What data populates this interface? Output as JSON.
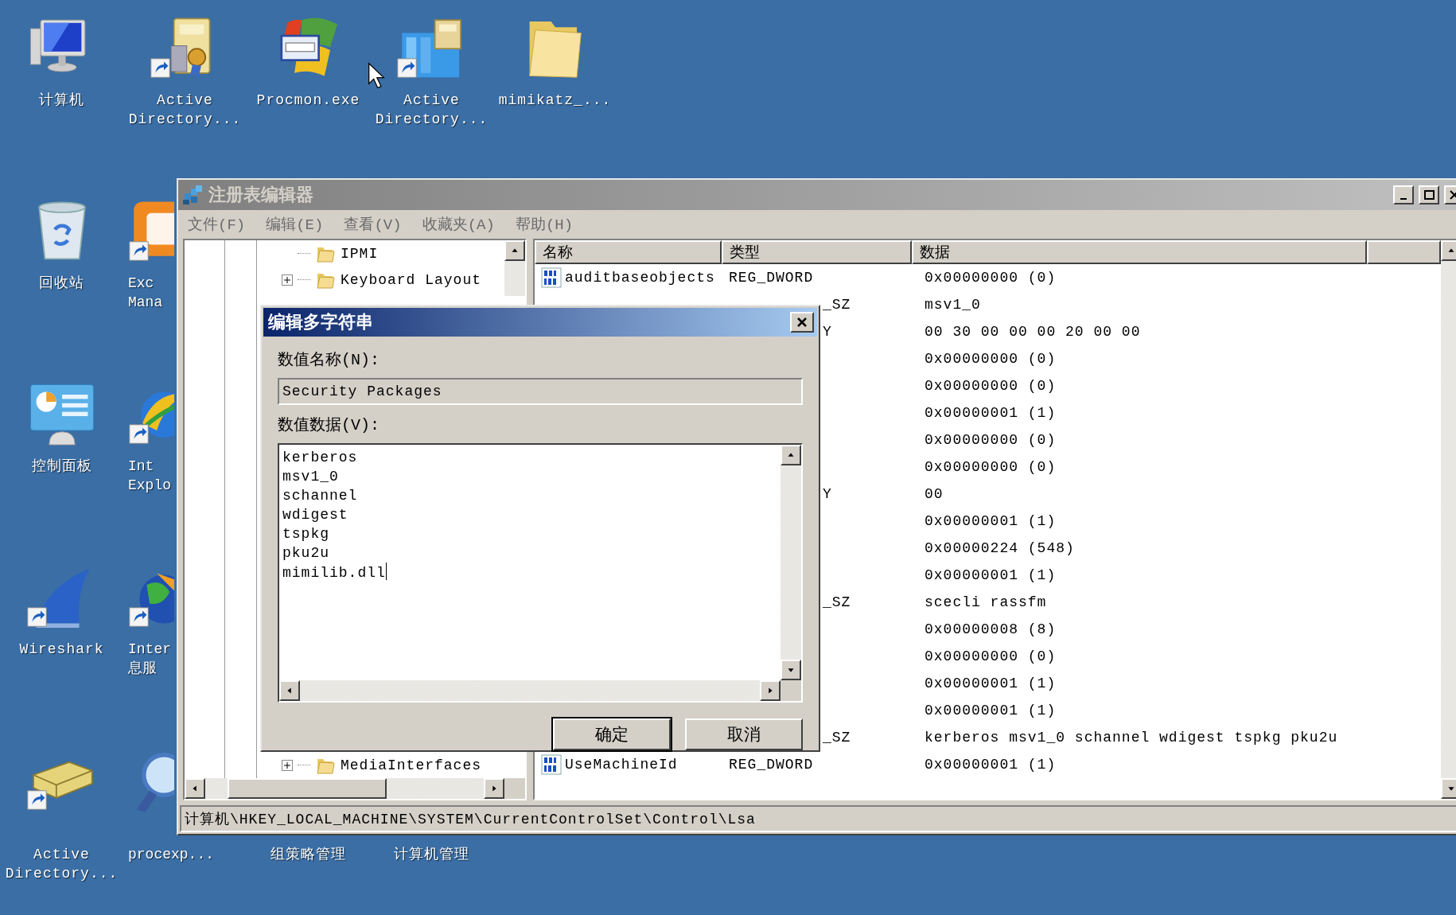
{
  "desktop_icons": [
    {
      "kind": "computer",
      "shortcut": false,
      "lines": [
        "计算机"
      ]
    },
    {
      "kind": "recycle_bin",
      "shortcut": false,
      "lines": [
        "回收站"
      ]
    },
    {
      "kind": "control_panel",
      "shortcut": false,
      "lines": [
        "控制面板"
      ]
    },
    {
      "kind": "shark_fin",
      "shortcut": true,
      "lines": [
        "Wireshark"
      ]
    },
    {
      "kind": "drive",
      "shortcut": true,
      "lines": [
        "Active",
        "Directory..."
      ]
    },
    {
      "kind": "book",
      "shortcut": true,
      "lines": [
        "Active",
        "Directory..."
      ]
    },
    {
      "kind": "app",
      "shortcut": true,
      "lines": [
        "Exc",
        "Mana"
      ]
    },
    {
      "kind": "browser",
      "shortcut": true,
      "lines": [
        "Int",
        "Explo"
      ]
    },
    {
      "kind": "globe",
      "shortcut": true,
      "lines": [
        "Inter",
        "息服"
      ]
    },
    {
      "kind": "magnifier",
      "shortcut": false,
      "lines": [
        "procexp..."
      ]
    },
    {
      "kind": "window",
      "shortcut": false,
      "lines": [
        "Procmon.exe"
      ]
    },
    {
      "kind": "covered",
      "lines": [
        "组策略管理"
      ]
    },
    {
      "kind": "building",
      "shortcut": true,
      "lines": [
        "Active",
        "Directory..."
      ]
    },
    {
      "kind": "covered",
      "lines": [
        "计算机管理"
      ]
    },
    {
      "kind": "folder",
      "shortcut": false,
      "lines": [
        "mimikatz_..."
      ]
    }
  ],
  "registry_editor": {
    "title": "注册表编辑器",
    "menu": [
      "文件(F)",
      "编辑(E)",
      "查看(V)",
      "收藏夹(A)",
      "帮助(H)"
    ],
    "tree": [
      {
        "label": "IPMI",
        "kind": "leaf"
      },
      {
        "label": "Keyboard Layout",
        "kind": "node",
        "expanded": false
      },
      {
        "label": "MediaInterfaces",
        "kind": "node",
        "expanded": false
      }
    ],
    "columns": [
      "名称",
      "类型",
      "数据"
    ],
    "rows": [
      {
        "kind": "full",
        "name": "auditbaseobjects",
        "type": "REG_DWORD",
        "data": "0x00000000 (0)"
      },
      {
        "kind": "covered",
        "type": "_SZ",
        "data": "msv1_0"
      },
      {
        "kind": "covered",
        "type": "Y",
        "data": "00 30 00 00 00 20 00 00"
      },
      {
        "kind": "covered",
        "data": "0x00000000 (0)"
      },
      {
        "kind": "covered",
        "data": "0x00000000 (0)"
      },
      {
        "kind": "covered",
        "data": "0x00000001 (1)"
      },
      {
        "kind": "covered",
        "data": "0x00000000 (0)"
      },
      {
        "kind": "covered",
        "data": "0x00000000 (0)"
      },
      {
        "kind": "covered",
        "type": "Y",
        "data": "00"
      },
      {
        "kind": "covered",
        "data": "0x00000001 (1)"
      },
      {
        "kind": "covered",
        "data": "0x00000224 (548)"
      },
      {
        "kind": "covered",
        "data": "0x00000001 (1)"
      },
      {
        "kind": "covered",
        "type": "_SZ",
        "data": "scecli rassfm"
      },
      {
        "kind": "covered",
        "data": "0x00000008 (8)"
      },
      {
        "kind": "covered",
        "data": "0x00000000 (0)"
      },
      {
        "kind": "covered",
        "data": "0x00000001 (1)"
      },
      {
        "kind": "covered",
        "data": "0x00000001 (1)"
      },
      {
        "kind": "covered",
        "type": "_SZ",
        "data": "kerberos msv1_0 schannel wdigest tspkg pku2u"
      },
      {
        "kind": "full",
        "name": "UseMachineId",
        "type": "REG_DWORD",
        "data": "0x00000001 (1)"
      }
    ],
    "status_bar": "计算机\\HKEY_LOCAL_MACHINE\\SYSTEM\\CurrentControlSet\\Control\\Lsa"
  },
  "dialog": {
    "title": "编辑多字符串",
    "name_label": "数值名称(N):",
    "name_field": {
      "value": "Security Packages",
      "read_only": true
    },
    "data_label": "数值数据(V):",
    "data_lines": [
      "kerberos",
      "msv1_0",
      "schannel",
      "wdigest",
      "tspkg",
      "pku2u",
      "mimilib.dll"
    ],
    "buttons": [
      {
        "label": "确定",
        "default": true
      },
      {
        "label": "取消",
        "default": false
      }
    ]
  }
}
